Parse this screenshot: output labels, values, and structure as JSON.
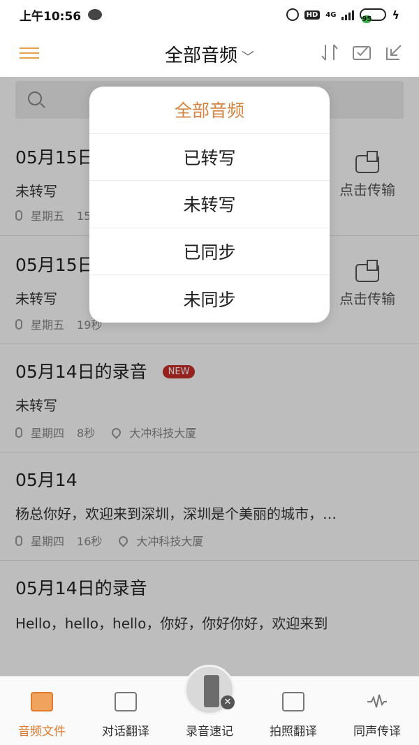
{
  "status_bar": {
    "time": "上午10:56",
    "battery": "95",
    "hd": "HD",
    "network": "4G"
  },
  "header": {
    "title": "全部音频",
    "chevron": "﹀"
  },
  "recordings": [
    {
      "title": "05月15日的录音",
      "new_badge": "",
      "status": "未转写",
      "weekday": "星期五",
      "duration": "15秒",
      "location": "",
      "sync_label": "点击传输"
    },
    {
      "title": "05月15日的录音",
      "new_badge": "",
      "status": "未转写",
      "weekday": "星期五",
      "duration": "19秒",
      "location": "",
      "sync_label": "点击传输"
    },
    {
      "title": "05月14日的录音",
      "new_badge": "NEW",
      "status": "未转写",
      "weekday": "星期四",
      "duration": "8秒",
      "location": "大冲科技大厦",
      "sync_label": ""
    },
    {
      "title": "05月14",
      "new_badge": "",
      "status": "杨总你好，欢迎来到深圳，深圳是个美丽的城市，…",
      "weekday": "星期四",
      "duration": "16秒",
      "location": "大冲科技大厦",
      "sync_label": ""
    },
    {
      "title": "05月14日的录音",
      "new_badge": "",
      "status": "Hello，hello，hello，你好，你好你好，欢迎来到",
      "weekday": "",
      "duration": "",
      "location": "",
      "sync_label": ""
    }
  ],
  "dropdown": {
    "items": [
      "全部音频",
      "已转写",
      "未转写",
      "已同步",
      "未同步"
    ],
    "selected": "全部音频"
  },
  "bottom_nav": [
    {
      "label": "音频文件",
      "icon": "music-file-icon",
      "active": true
    },
    {
      "label": "对话翻译",
      "icon": "chat-translate-icon",
      "active": false
    },
    {
      "label": "录音速记",
      "icon": "recorder-icon",
      "active": false
    },
    {
      "label": "拍照翻译",
      "icon": "camera-icon",
      "active": false
    },
    {
      "label": "同声传译",
      "icon": "waveform-icon",
      "active": false
    }
  ],
  "colors": {
    "accent": "#d5843f",
    "new_badge": "#c8302a",
    "menu": "#e6a24a"
  }
}
